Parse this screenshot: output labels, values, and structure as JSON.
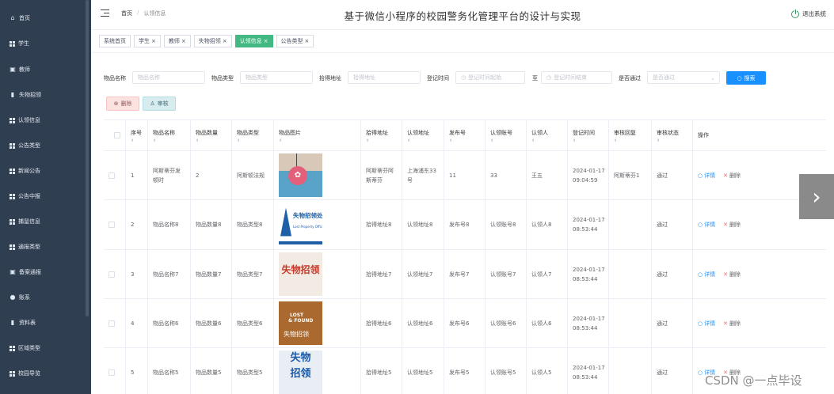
{
  "sidebar": {
    "items": [
      {
        "label": "首页",
        "icon": "home-icon"
      },
      {
        "label": "学生",
        "icon": "grid-icon"
      },
      {
        "label": "教师",
        "icon": "clipboard-icon"
      },
      {
        "label": "失物招领",
        "icon": "bar-chart-icon"
      },
      {
        "label": "认领信息",
        "icon": "grid-icon"
      },
      {
        "label": "公告类型",
        "icon": "grid-icon"
      },
      {
        "label": "新闻公告",
        "icon": "grid-icon"
      },
      {
        "label": "公告中报",
        "icon": "grid-icon"
      },
      {
        "label": "捕鼠信息",
        "icon": "grid-icon"
      },
      {
        "label": "通报类型",
        "icon": "grid-icon"
      },
      {
        "label": "备案通报",
        "icon": "clipboard-icon"
      },
      {
        "label": "账系",
        "icon": "user-icon"
      },
      {
        "label": "资料表",
        "icon": "bar-chart-icon"
      },
      {
        "label": "区域类型",
        "icon": "grid-icon"
      },
      {
        "label": "校园导览",
        "icon": "grid-icon"
      }
    ]
  },
  "header": {
    "breadcrumb": {
      "home": "首页",
      "separator": "/",
      "current": "认领信息"
    },
    "title": "基于微信小程序的校园警务化管理平台的设计与实现",
    "logout": "退出系统"
  },
  "tabs": [
    {
      "label": "系统首页",
      "closable": false
    },
    {
      "label": "学生",
      "closable": true
    },
    {
      "label": "教师",
      "closable": true
    },
    {
      "label": "失物招领",
      "closable": true
    },
    {
      "label": "认领信息",
      "closable": true,
      "active": true
    },
    {
      "label": "公告类型",
      "closable": true
    }
  ],
  "search": {
    "name_label": "物品名称",
    "name_placeholder": "物品名称",
    "type_label": "物品类型",
    "type_placeholder": "物品类型",
    "addr_label": "拾得地址",
    "addr_placeholder": "拾得地址",
    "time_label": "登记时间",
    "time_start_placeholder": "登记时间起始",
    "to_label": "至",
    "time_end_placeholder": "登记时间结束",
    "pass_label": "是否通过",
    "pass_placeholder": "是否通过",
    "button": "搜索"
  },
  "actions": {
    "delete": "删除",
    "audit": "审核"
  },
  "table": {
    "headers": [
      "序号",
      "物品名称",
      "物品数量",
      "物品类型",
      "物品图片",
      "拾得地址",
      "认领地址",
      "发布号",
      "认领账号",
      "认领人",
      "登记时间",
      "审核回复",
      "审核状态",
      "操作"
    ],
    "rows": [
      {
        "no": "1",
        "name": "阿斯蒂芬发顿时",
        "qty": "2",
        "type": "阿斯顿法规",
        "pickup": "阿斯蒂芬阿斯蒂芬",
        "claim_addr": "上海浦东33号",
        "pub": "11",
        "acct": "33",
        "person": "王五",
        "time": "2024-01-17 09:04:59",
        "reply": "阿斯蒂芬1",
        "status": "通过"
      },
      {
        "no": "2",
        "name": "物品名称8",
        "qty": "物品数量8",
        "type": "物品类型8",
        "pickup": "拾得地址8",
        "claim_addr": "认领地址8",
        "pub": "发布号8",
        "acct": "认领账号8",
        "person": "认领人8",
        "time": "2024-01-17 08:53:44",
        "reply": "",
        "status": "通过"
      },
      {
        "no": "3",
        "name": "物品名称7",
        "qty": "物品数量7",
        "type": "物品类型7",
        "pickup": "拾得地址7",
        "claim_addr": "认领地址7",
        "pub": "发布号7",
        "acct": "认领账号7",
        "person": "认领人7",
        "time": "2024-01-17 08:53:44",
        "reply": "",
        "status": "通过"
      },
      {
        "no": "4",
        "name": "物品名称6",
        "qty": "物品数量6",
        "type": "物品类型6",
        "pickup": "拾得地址6",
        "claim_addr": "认领地址6",
        "pub": "发布号6",
        "acct": "认领账号6",
        "person": "认领人6",
        "time": "2024-01-17 08:53:44",
        "reply": "",
        "status": "通过"
      },
      {
        "no": "5",
        "name": "物品名称5",
        "qty": "物品数量5",
        "type": "物品类型5",
        "pickup": "拾得地址5",
        "claim_addr": "认领地址5",
        "pub": "发布号5",
        "acct": "认领账号5",
        "person": "认领人5",
        "time": "2024-01-17 08:53:44",
        "reply": "",
        "status": "通过"
      }
    ],
    "op_detail": "详情",
    "op_delete": "删除"
  },
  "images": {
    "img2_title": "失物招领处",
    "img2_sub": "Lost Property Office",
    "img3_text": "失物招领",
    "img4_en1": "LOST",
    "img4_en2": "& FOUND",
    "img4_cn": "失物招领",
    "img5_l1": "失物",
    "img5_l2": "招领"
  },
  "watermark": "CSDN @一点毕设",
  "colors": {
    "sidebar": "#2f3e50",
    "accent": "#42b983",
    "primary": "#1890ff",
    "danger": "#f56c6c"
  }
}
